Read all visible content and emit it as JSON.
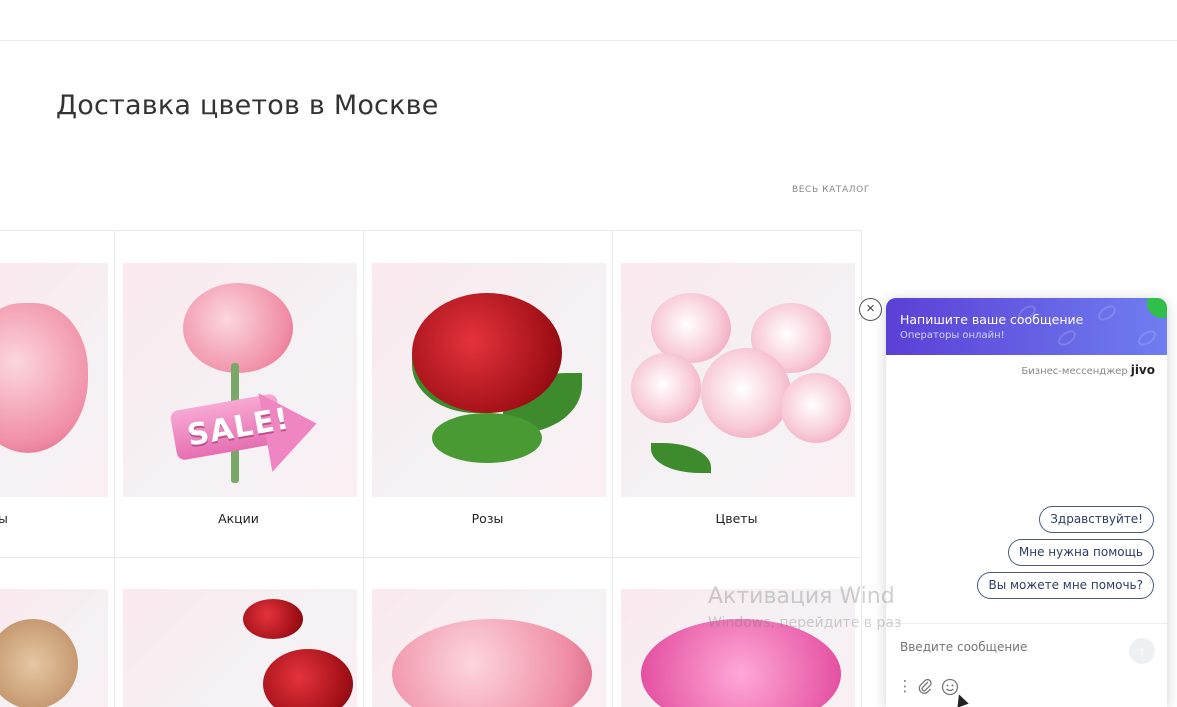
{
  "page": {
    "title": "Доставка цветов в Москве",
    "catalog_link": "ВЕСЬ КАТАЛОГ"
  },
  "categories": [
    {
      "label": "ы"
    },
    {
      "label": "Акции"
    },
    {
      "label": "Розы"
    },
    {
      "label": "Цветы"
    }
  ],
  "sale_text": "SALE!",
  "chat": {
    "header_title": "Напишите ваше сообщение",
    "header_sub": "Операторы онлайн!",
    "brand_prefix": "Бизнес-мессенджер",
    "brand_name": "jivo",
    "quick_replies": [
      "Здравствуйте!",
      "Мне нужна помощь",
      "Вы можете мне помочь?"
    ],
    "input_placeholder": "Введите сообщение",
    "close_symbol": "×",
    "send_symbol": "↑",
    "online_color": "#2fbf4a",
    "accent": "#5b3fd6"
  },
  "watermark": {
    "line1": "Активация Wind",
    "line2": "Windows, перейдите в раз"
  }
}
